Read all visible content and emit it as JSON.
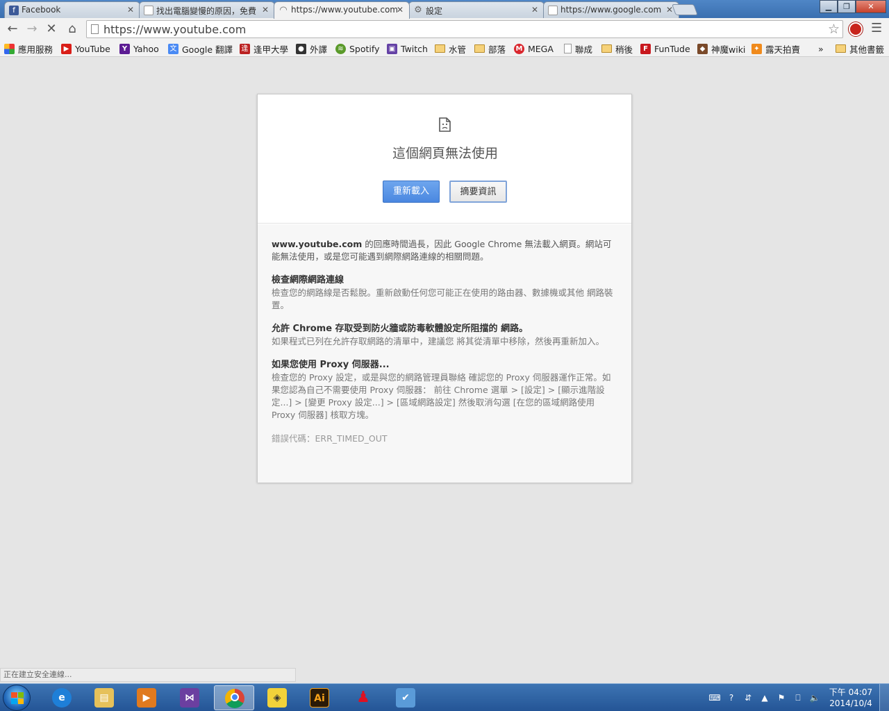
{
  "tabs": [
    {
      "title": "Facebook",
      "icon": "facebook-icon",
      "color": "#3b5998"
    },
    {
      "title": "找出電腦變慢的原因，免費",
      "icon": "page-icon",
      "color": "#888888"
    },
    {
      "title": "https://www.youtube.com",
      "icon": "loading-spinner-icon",
      "color": "#666666",
      "active": true
    },
    {
      "title": "設定",
      "icon": "gear-icon",
      "color": "#666666"
    },
    {
      "title": "https://www.google.com",
      "icon": "page-icon",
      "color": "#888888"
    }
  ],
  "address_bar": {
    "url": "https://www.youtube.com"
  },
  "bookmarks": [
    {
      "label": "應用服務",
      "icon": "apps-grid-icon"
    },
    {
      "label": "YouTube",
      "icon": "youtube-icon"
    },
    {
      "label": "Yahoo",
      "icon": "yahoo-icon"
    },
    {
      "label": "Google 翻譯",
      "icon": "google-translate-icon"
    },
    {
      "label": "逢甲大學",
      "icon": "fcu-icon"
    },
    {
      "label": "外譯",
      "icon": "person-icon"
    },
    {
      "label": "Spotify",
      "icon": "spotify-icon"
    },
    {
      "label": "Twitch",
      "icon": "twitch-icon"
    },
    {
      "label": "水管",
      "icon": "folder-icon"
    },
    {
      "label": "部落",
      "icon": "folder-icon"
    },
    {
      "label": "MEGA",
      "icon": "mega-icon"
    },
    {
      "label": "聯成",
      "icon": "page-icon"
    },
    {
      "label": "稍後",
      "icon": "folder-icon"
    },
    {
      "label": "FunTude",
      "icon": "funtude-icon"
    },
    {
      "label": "神魔wiki",
      "icon": "tos-wiki-icon"
    },
    {
      "label": "露天拍賣",
      "icon": "ruten-icon"
    }
  ],
  "bookmarks_overflow": "»",
  "other_bookmarks": "其他書籤",
  "error_page": {
    "title": "這個網頁無法使用",
    "reload_button": "重新載入",
    "details_button": "摘要資訊",
    "intro_bold": "www.youtube.com",
    "intro_text": " 的回應時間過長，因此 Google Chrome 無法載入網頁。網站可能無法使用，或是您可能遇到網際網路連線的相關問題。",
    "sections": [
      {
        "heading": "檢查網際網路連線",
        "body": "檢查您的網路線是否鬆脫。重新啟動任何您可能正在使用的路由器、數據機或其他 網路裝置。"
      },
      {
        "heading": "允許 Chrome 存取受到防火牆或防毒軟體設定所阻擋的 網路。",
        "body": "如果程式已列在允許存取網路的清單中，建議您 將其從清單中移除，然後再重新加入。"
      },
      {
        "heading": "如果您使用 Proxy 伺服器...",
        "body": "檢查您的 Proxy 設定，或是與您的網路管理員聯絡 確認您的 Proxy 伺服器運作正常。如果您認為自己不需要使用 Proxy 伺服器： 前往 Chrome 選單 > [設定] > [顯示進階設定...] > [變更 Proxy 設定...] > [區域網路設定] 然後取消勾選 [在您的區域網路使用 Proxy 伺服器] 核取方塊。"
      }
    ],
    "error_code": "錯誤代碼：ERR_TIMED_OUT"
  },
  "status_bar": {
    "text": "正在建立安全連線..."
  },
  "taskbar": {
    "apps": [
      {
        "name": "internet-explorer-icon"
      },
      {
        "name": "file-explorer-icon"
      },
      {
        "name": "media-player-icon"
      },
      {
        "name": "visual-studio-icon"
      },
      {
        "name": "chrome-icon",
        "active": true
      },
      {
        "name": "pin-app-icon"
      },
      {
        "name": "illustrator-icon",
        "label": "Ai"
      },
      {
        "name": "character-app-icon"
      },
      {
        "name": "network-tasks-icon"
      }
    ],
    "clock": {
      "time": "下午 04:07",
      "date": "2014/10/4"
    }
  },
  "colors": {
    "primary_button": "#4a87e0",
    "taskbar": "#245596",
    "page_background": "#e5e5e5"
  }
}
